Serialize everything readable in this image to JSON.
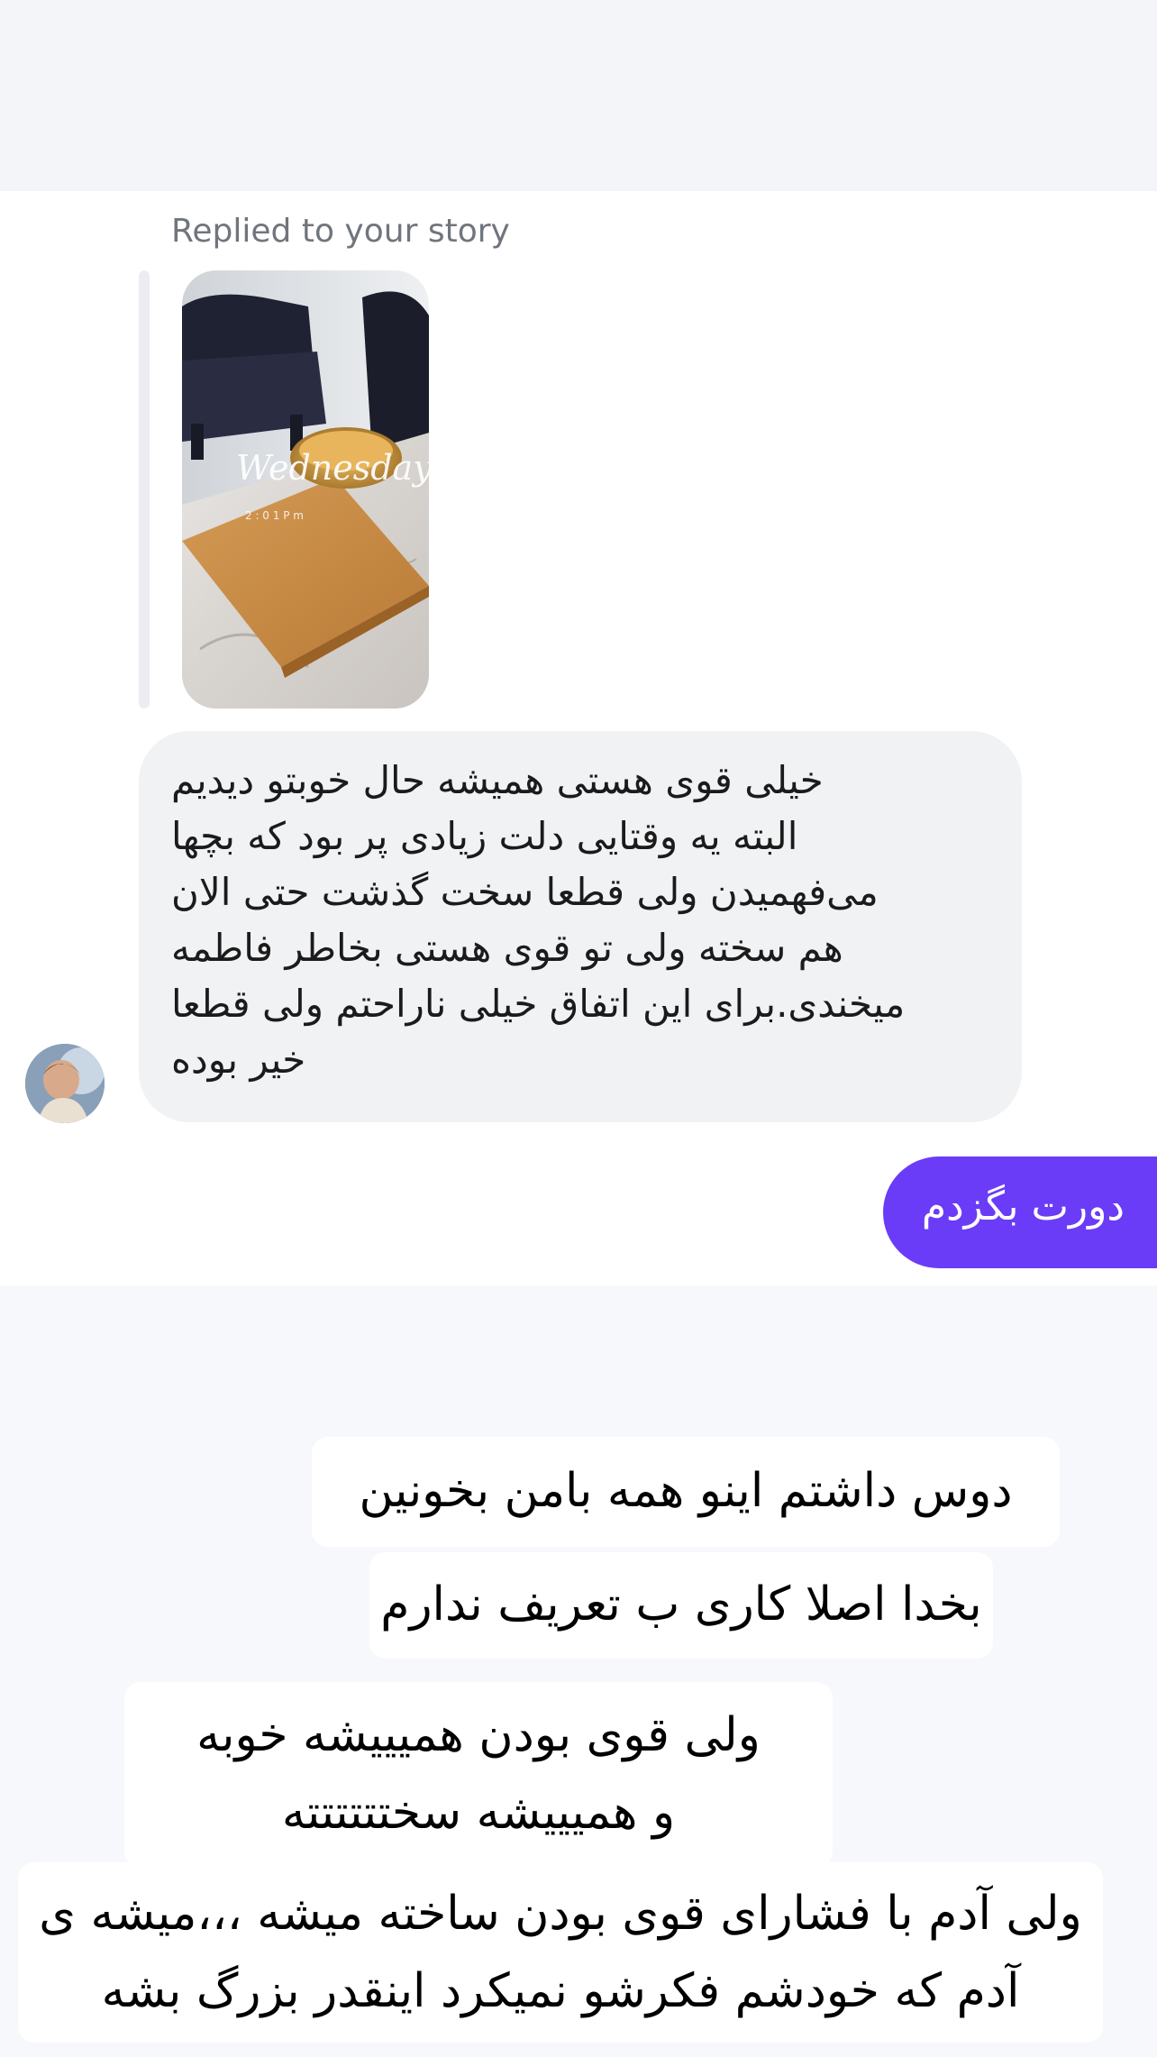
{
  "story_reply": {
    "label": "Replied to your story",
    "story_overlay": {
      "day": "Wednesday",
      "time": "2 : 0 1   P m"
    }
  },
  "incoming_message": {
    "text": "خیلی قوی هستی همیشه حال خوبتو دیدیم\nالبته یه وقتایی دلت زیادی پر بود که بچها\nمی‌فهمیدن ولی قطعا سخت گذشت حتی الان\nهم سخته ولی تو قوی هستی بخاطر فاطمه\nمیخندی.برای این اتفاق خیلی ناراحتم ولی قطعا\nخیر بوده"
  },
  "outgoing_message": {
    "text": "دورت بگزدم"
  },
  "captions": [
    "دوس داشتم اینو همه بامن بخونین",
    "بخدا اصلا کاری ب تعریف ندارم",
    "ولی قوی بودن همیییشه خوبه\nو همیییشه سختتتتتته",
    "ولی آدم با فشارای قوی بودن ساخته میشه ،،،میشه ی\nآدم که خودشم فکرشو نمیکرد اینقدر بزرگ بشه"
  ],
  "colors": {
    "outgoing_bubble": "#6a3cf7",
    "incoming_bubble": "#f1f2f4",
    "label_gray": "#70757d"
  }
}
